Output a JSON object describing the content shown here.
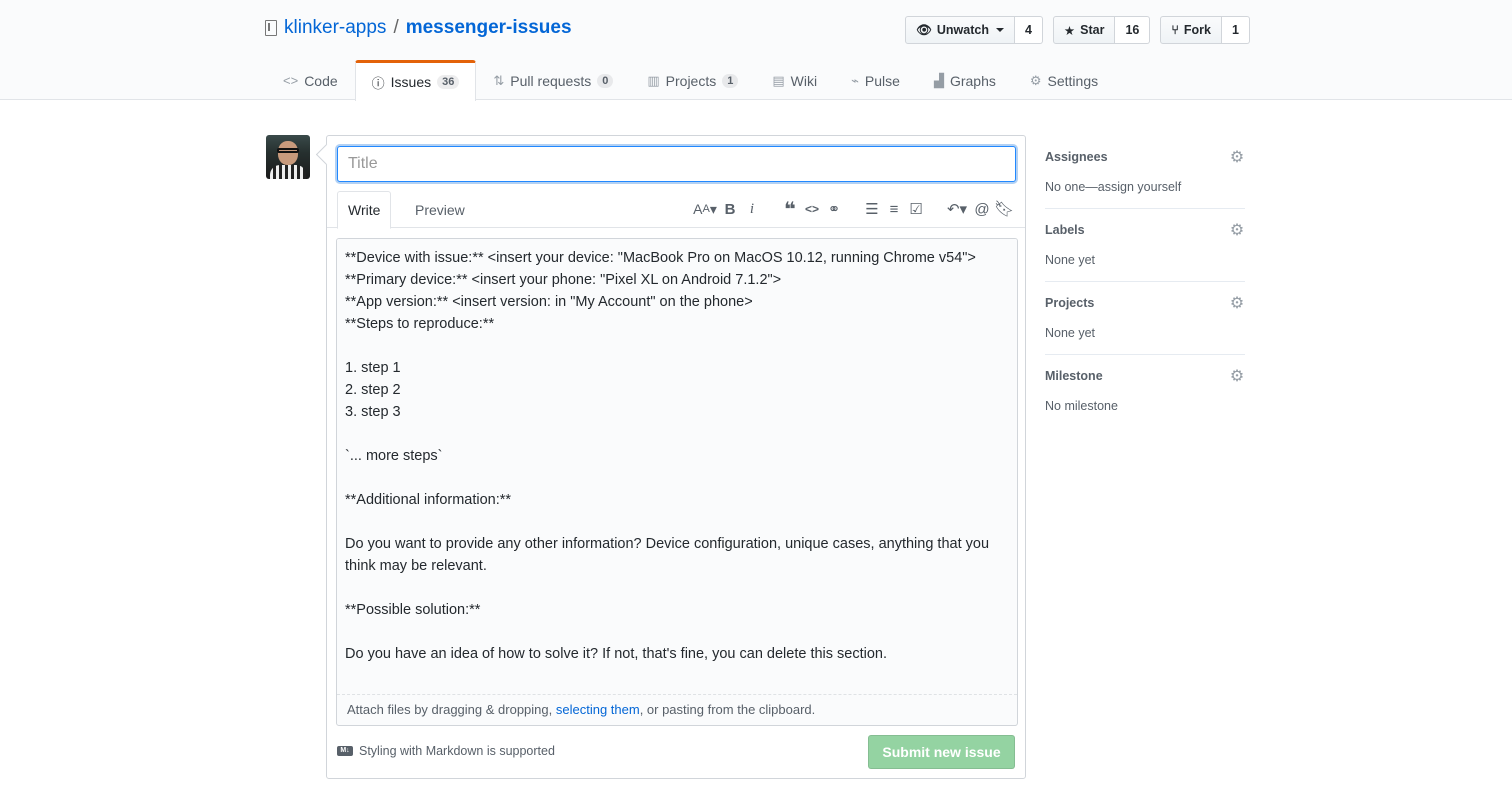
{
  "repo": {
    "owner": "klinker-apps",
    "separator": "/",
    "name": "messenger-issues"
  },
  "actions": {
    "watch": {
      "label": "Unwatch",
      "count": "4"
    },
    "star": {
      "label": "Star",
      "count": "16"
    },
    "fork": {
      "label": "Fork",
      "count": "1"
    }
  },
  "tabs": [
    {
      "label": "Code",
      "icon": "code-icon"
    },
    {
      "label": "Issues",
      "count": "36",
      "icon": "issue-icon"
    },
    {
      "label": "Pull requests",
      "count": "0",
      "icon": "pull-request-icon"
    },
    {
      "label": "Projects",
      "count": "1",
      "icon": "project-icon"
    },
    {
      "label": "Wiki",
      "icon": "book-icon"
    },
    {
      "label": "Pulse",
      "icon": "pulse-icon"
    },
    {
      "label": "Graphs",
      "icon": "graph-icon"
    },
    {
      "label": "Settings",
      "icon": "gear-icon"
    }
  ],
  "form": {
    "title_placeholder": "Title",
    "write_tab": "Write",
    "preview_tab": "Preview",
    "body": "**Device with issue:** <insert your device: \"MacBook Pro on MacOS 10.12, running Chrome v54\">\n**Primary device:** <insert your phone: \"Pixel XL on Android 7.1.2\">\n**App version:** <insert version: in \"My Account\" on the phone>\n**Steps to reproduce:**\n\n1. step 1\n2. step 2\n3. step 3\n\n`... more steps`\n\n**Additional information:**\n\nDo you want to provide any other information? Device configuration, unique cases, anything that you think may be relevant.\n\n**Possible solution:**\n\nDo you have an idea of how to solve it? If not, that's fine, you can delete this section.",
    "attach_prefix": "Attach files by dragging & dropping, ",
    "attach_link": "selecting them",
    "attach_suffix": ", or pasting from the clipboard.",
    "markdown_note": "Styling with Markdown is supported",
    "submit": "Submit new issue",
    "submit_color": "#94d3a2"
  },
  "sidebar": {
    "assignees": {
      "heading": "Assignees",
      "value": "No one—assign yourself"
    },
    "labels": {
      "heading": "Labels",
      "value": "None yet"
    },
    "projects": {
      "heading": "Projects",
      "value": "None yet"
    },
    "milestone": {
      "heading": "Milestone",
      "value": "No milestone"
    }
  },
  "colors": {
    "accent": "#e36209",
    "link": "#0366d6"
  }
}
